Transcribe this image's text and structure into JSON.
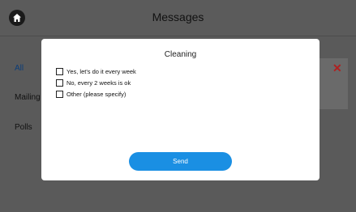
{
  "header": {
    "title": "Messages",
    "home_icon": "home-icon"
  },
  "sidebar": {
    "items": [
      {
        "label": "All"
      },
      {
        "label": "Mailing"
      },
      {
        "label": "Polls"
      }
    ]
  },
  "background_card": {
    "close_icon": "close-icon",
    "close_glyph": "✕",
    "close_color": "#b02020"
  },
  "dialog": {
    "title": "Cleaning",
    "options": [
      {
        "label": "Yes, let's do it every week",
        "checked": false
      },
      {
        "label": "No, every 2 weeks is ok",
        "checked": false
      },
      {
        "label": "Other (please specify)",
        "checked": false
      }
    ],
    "send_label": "Send"
  },
  "colors": {
    "accent": "#1a8fe3",
    "overlay": "#5a5a5a"
  }
}
